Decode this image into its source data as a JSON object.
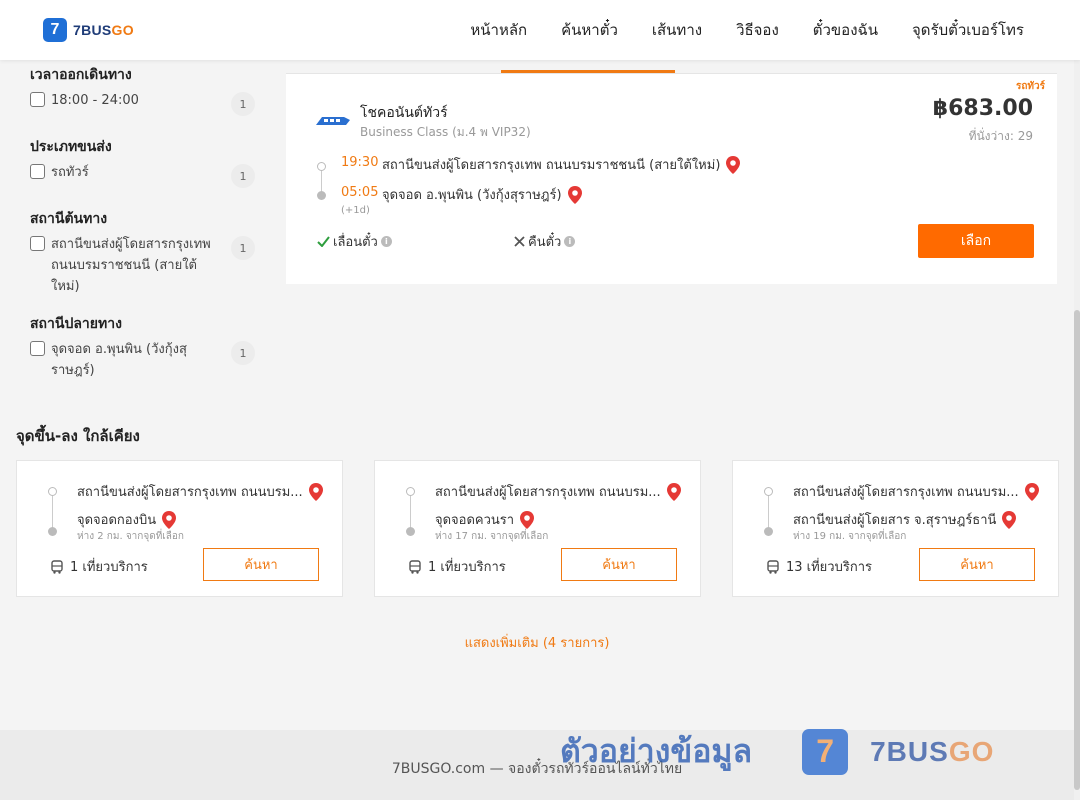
{
  "header": {
    "logo_number": "7",
    "logo_text": "7BUS",
    "logo_text_accent": "GO",
    "nav": [
      "หน้าหลัก",
      "ค้นหาตั๋ว",
      "เส้นทาง",
      "วิธีจอง",
      "ตั๋วของฉัน",
      "จุดรับตั๋วเบอร์โทร"
    ]
  },
  "filters": {
    "departure_time": {
      "title": "เวลาออกเดินทาง",
      "option": "18:00 - 24:00",
      "count": "1"
    },
    "transport_type": {
      "title": "ประเภทขนส่ง",
      "option": "รถทัวร์",
      "count": "1"
    },
    "origin": {
      "title": "สถานีต้นทาง",
      "option": "สถานีขนส่งผู้โดยสารกรุงเทพ ถนนบรมราชชนนี (สายใต้ใหม่)",
      "count": "1"
    },
    "destination": {
      "title": "สถานีปลายทาง",
      "option": "จุดจอด อ.พุนพิน (วังกุ้งสุราษฎร์)",
      "count": "1"
    }
  },
  "trip": {
    "tag": "รถทัวร์",
    "operator": "โชคอนันต์ทัวร์",
    "bus_class": "Business Class (ม.4 พ VIP32)",
    "price": "฿683.00",
    "seats": "ที่นั่งว่าง: 29",
    "depart_time": "19:30",
    "depart_station": "สถานีขนส่งผู้โดยสารกรุงเทพ ถนนบรมราชชนนี (สายใต้ใหม่)",
    "arrive_time": "05:05",
    "arrive_station": "จุดจอด อ.พุนพิน (วังกุ้งสุราษฎร์)",
    "plus_day": "(+1d)",
    "reschedule": "เลื่อนตั๋ว",
    "refund": "คืนตั๋ว",
    "select_label": "เลือก"
  },
  "nearby": {
    "title": "จุดขึ้น-ลง ใกล้เคียง",
    "cards": [
      {
        "from": "สถานีขนส่งผู้โดยสารกรุงเทพ ถนนบรม...",
        "to": "จุดจอดกองบิน",
        "distance": "ห่าง 2 กม. จากจุดที่เลือก",
        "trips": "1 เที่ยวบริการ",
        "button": "ค้นหา"
      },
      {
        "from": "สถานีขนส่งผู้โดยสารกรุงเทพ ถนนบรม...",
        "to": "จุดจอดควนรา",
        "distance": "ห่าง 17 กม. จากจุดที่เลือก",
        "trips": "1 เที่ยวบริการ",
        "button": "ค้นหา"
      },
      {
        "from": "สถานีขนส่งผู้โดยสารกรุงเทพ ถนนบรม...",
        "to": "สถานีขนส่งผู้โดยสาร จ.สุราษฎร์ธานี",
        "distance": "ห่าง 19 กม. จากจุดที่เลือก",
        "trips": "13 เที่ยวบริการ",
        "button": "ค้นหา"
      }
    ],
    "show_more": "แสดงเพิ่มเติม (4 รายการ)"
  },
  "footer": {
    "text": "7BUSGO.com — จองตั๋วรถทัวร์ออนไลน์ทั่วไทย"
  },
  "watermark": {
    "text": "ตัวอย่างข้อมูล",
    "badge": "7",
    "name": "7BUS",
    "name_accent": "GO"
  },
  "colors": {
    "accent": "#f07a13",
    "button": "#ff6a00",
    "pin": "#e53935",
    "brand_blue": "#1f6fd6"
  }
}
